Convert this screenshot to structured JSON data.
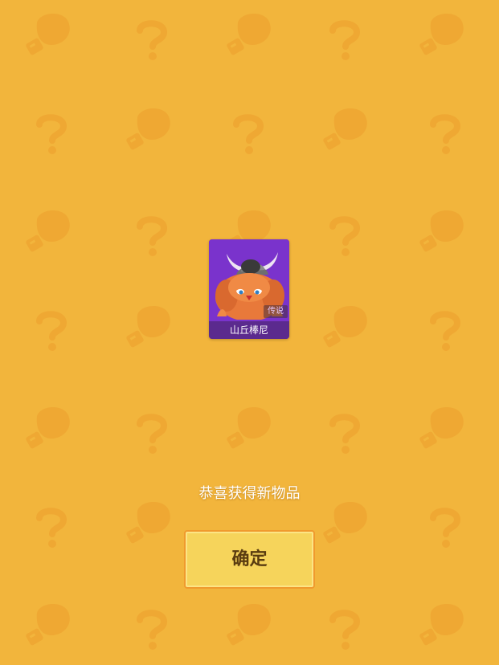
{
  "reward_card": {
    "name": "山丘棒尼",
    "rarity": "传说",
    "image": "orange-furry-horned-monster-portrait"
  },
  "message": "恭喜获得新物品",
  "confirm_button": {
    "label": "确定"
  },
  "colors": {
    "background": "#F2B53C",
    "pattern": "#EFA833",
    "card_bg": "#7A33CC",
    "button_bg": "#F6D45B",
    "button_border": "#F09A2E"
  },
  "icons": {
    "pattern_icons": [
      "boxing-glove-icon",
      "question-mark-icon"
    ]
  }
}
